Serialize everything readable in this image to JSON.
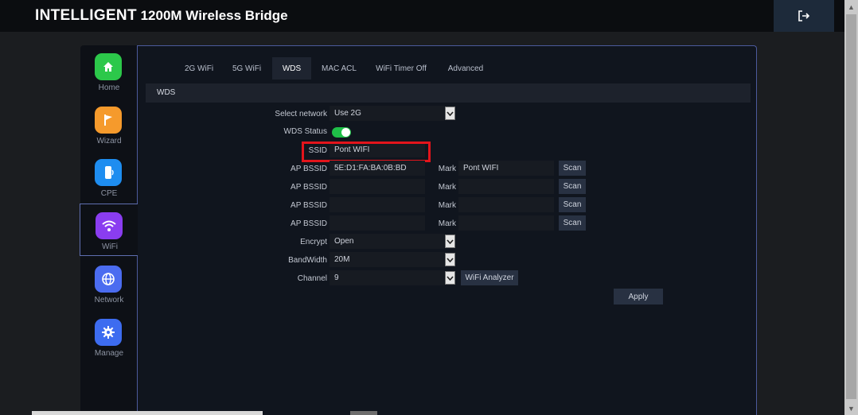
{
  "header": {
    "brand_main": "INTELLIGENT",
    "brand_rest": "1200M Wireless Bridge",
    "logout_icon": "logout-icon"
  },
  "sidebar": {
    "items": [
      {
        "label": "Home",
        "icon": "home-icon",
        "color": "#2cc84a"
      },
      {
        "label": "Wizard",
        "icon": "flag-icon",
        "color": "#f59a2c"
      },
      {
        "label": "CPE",
        "icon": "cpe-icon",
        "color": "#1e8df0"
      },
      {
        "label": "WiFi",
        "icon": "wifi-icon",
        "color": "#8a3df0"
      },
      {
        "label": "Network",
        "icon": "globe-icon",
        "color": "#4b6cf0"
      },
      {
        "label": "Manage",
        "icon": "gear-icon",
        "color": "#3d6cf0"
      }
    ]
  },
  "tabs": [
    "2G WiFi",
    "5G WiFi",
    "WDS",
    "MAC ACL",
    "WiFi Timer Off",
    "Advanced"
  ],
  "section_title": "WDS",
  "form": {
    "select_network_label": "Select network",
    "select_network_value": "Use 2G",
    "wds_status_label": "WDS Status",
    "wds_status_on": true,
    "ssid_label": "SSID",
    "ssid_value": "Pont WIFI",
    "ap_rows": [
      {
        "label": "AP BSSID",
        "value": "5E:D1:FA:BA:0B:BD",
        "mark_label": "Mark",
        "mark_value": "Pont WIFI",
        "scan": "Scan"
      },
      {
        "label": "AP BSSID",
        "value": "",
        "mark_label": "Mark",
        "mark_value": "",
        "scan": "Scan"
      },
      {
        "label": "AP BSSID",
        "value": "",
        "mark_label": "Mark",
        "mark_value": "",
        "scan": "Scan"
      },
      {
        "label": "AP BSSID",
        "value": "",
        "mark_label": "Mark",
        "mark_value": "",
        "scan": "Scan"
      }
    ],
    "encrypt_label": "Encrypt",
    "encrypt_value": "Open",
    "bandwidth_label": "BandWidth",
    "bandwidth_value": "20M",
    "channel_label": "Channel",
    "channel_value": "9",
    "wifi_analyzer": "WiFi Analyzer",
    "apply": "Apply"
  },
  "colors": {
    "highlight": "#e3141b",
    "toggle_on": "#1fbf48"
  }
}
